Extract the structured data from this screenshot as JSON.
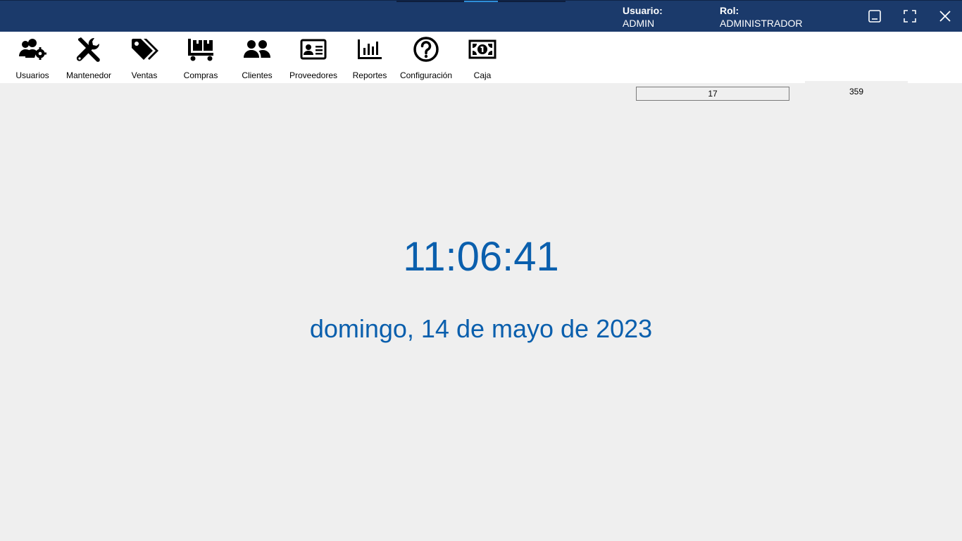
{
  "titlebar": {
    "user_label": "Usuario:",
    "user_value": "ADMIN",
    "role_label": "Rol:",
    "role_value": "ADMINISTRADOR",
    "background_color": "#1b3a6b",
    "window_buttons": [
      "minimize-icon",
      "maximize-icon",
      "close-icon"
    ]
  },
  "toolbar": {
    "items": [
      {
        "label": "Usuarios",
        "icon": "users-gear-icon"
      },
      {
        "label": "Mantenedor",
        "icon": "tools-icon"
      },
      {
        "label": "Ventas",
        "icon": "tags-icon"
      },
      {
        "label": "Compras",
        "icon": "dolly-icon"
      },
      {
        "label": "Clientes",
        "icon": "user-group-icon"
      },
      {
        "label": "Proveedores",
        "icon": "id-card-icon"
      },
      {
        "label": "Reportes",
        "icon": "bar-chart-icon"
      },
      {
        "label": "Configuración",
        "icon": "question-circle-icon"
      },
      {
        "label": "Caja",
        "icon": "money-bill-icon"
      }
    ],
    "counter_1": "17",
    "counter_2": "359"
  },
  "main": {
    "time": "11:06:41",
    "date": "domingo, 14 de mayo de 2023",
    "accent_color": "#0a5fad"
  }
}
